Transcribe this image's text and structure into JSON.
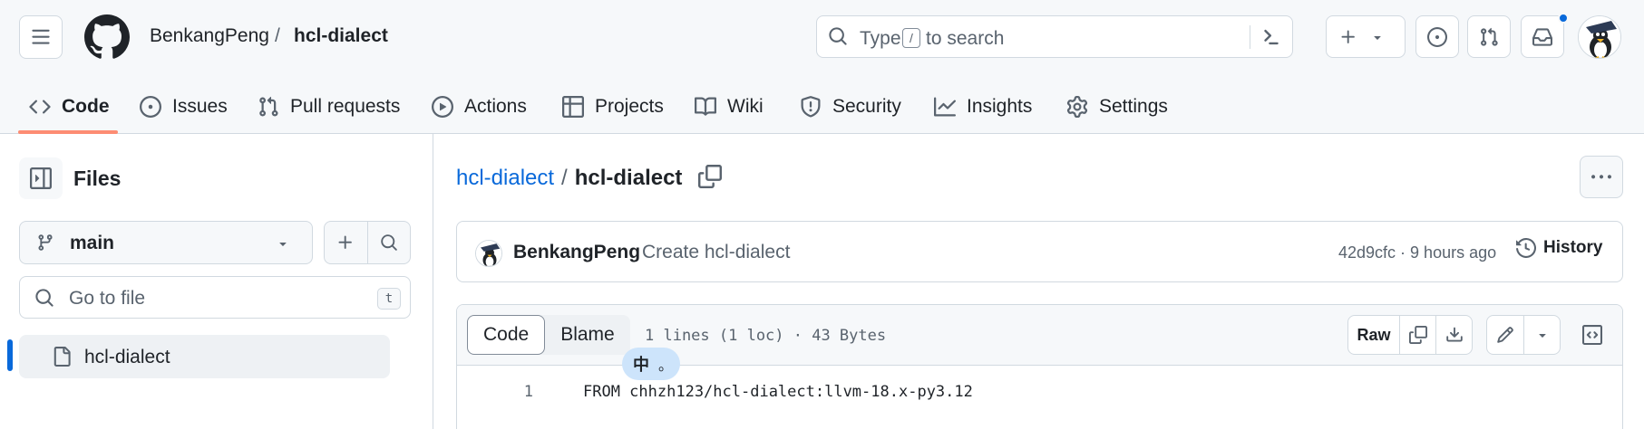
{
  "header": {
    "owner": "BenkangPeng",
    "separator": "/",
    "repo": "hcl-dialect",
    "search": {
      "text_before": "Type",
      "key": "/",
      "text_after": "to search"
    }
  },
  "tabs": [
    {
      "label": "Code",
      "icon": "code-icon",
      "active": true
    },
    {
      "label": "Issues",
      "icon": "issue-icon"
    },
    {
      "label": "Pull requests",
      "icon": "pull-request-icon"
    },
    {
      "label": "Actions",
      "icon": "play-icon"
    },
    {
      "label": "Projects",
      "icon": "table-icon"
    },
    {
      "label": "Wiki",
      "icon": "book-icon"
    },
    {
      "label": "Security",
      "icon": "shield-icon"
    },
    {
      "label": "Insights",
      "icon": "graph-icon"
    },
    {
      "label": "Settings",
      "icon": "gear-icon"
    }
  ],
  "sidebar": {
    "title": "Files",
    "branch": "main",
    "goto_placeholder": "Go to file",
    "goto_key": "t",
    "tree": [
      {
        "label": "hcl-dialect",
        "selected": true
      }
    ]
  },
  "main": {
    "path_root": "hcl-dialect",
    "path_sep": "/",
    "path_file": "hcl-dialect",
    "commit": {
      "author": "BenkangPeng",
      "message": "Create hcl-dialect",
      "meta": "42d9cfc · 9 hours ago",
      "history_label": "History"
    },
    "file": {
      "tab_code": "Code",
      "tab_blame": "Blame",
      "info": "1 lines (1 loc) · 43 Bytes",
      "raw_label": "Raw",
      "lines": [
        {
          "num": "1",
          "code": "FROM chhzh123/hcl-dialect:llvm-18.x-py3.12"
        }
      ]
    }
  },
  "ime": {
    "char": "中",
    "dot": "。"
  },
  "colors": {
    "accent": "#0969da",
    "tab_underline": "#fd8c73",
    "notification": "#0969da"
  }
}
